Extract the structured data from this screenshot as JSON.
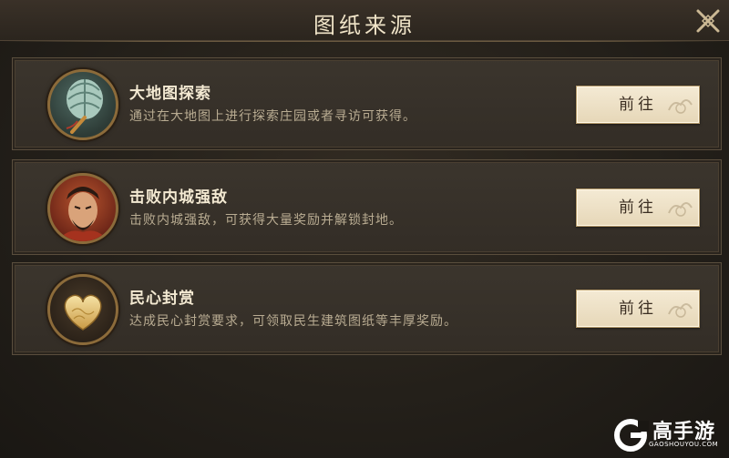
{
  "dialog": {
    "title": "图纸来源"
  },
  "sources": [
    {
      "title": "大地图探索",
      "description": "通过在大地图上进行探索庄园或者寻访可获得。",
      "button_label": "前往",
      "icon": "feather-fan-icon"
    },
    {
      "title": "击败内城强敌",
      "description": "击败内城强敌，可获得大量奖励并解锁封地。",
      "button_label": "前往",
      "icon": "warrior-portrait-icon"
    },
    {
      "title": "民心封赏",
      "description": "达成民心封赏要求，可领取民生建筑图纸等丰厚奖励。",
      "button_label": "前往",
      "icon": "golden-heart-icon"
    }
  ],
  "watermark": {
    "brand": "高手游",
    "url": "GAOSHOUYOU.COM"
  },
  "colors": {
    "accent_gold": "#8c6b3a",
    "button_bg": "#f4ead4",
    "panel_bg": "#3b352d"
  }
}
